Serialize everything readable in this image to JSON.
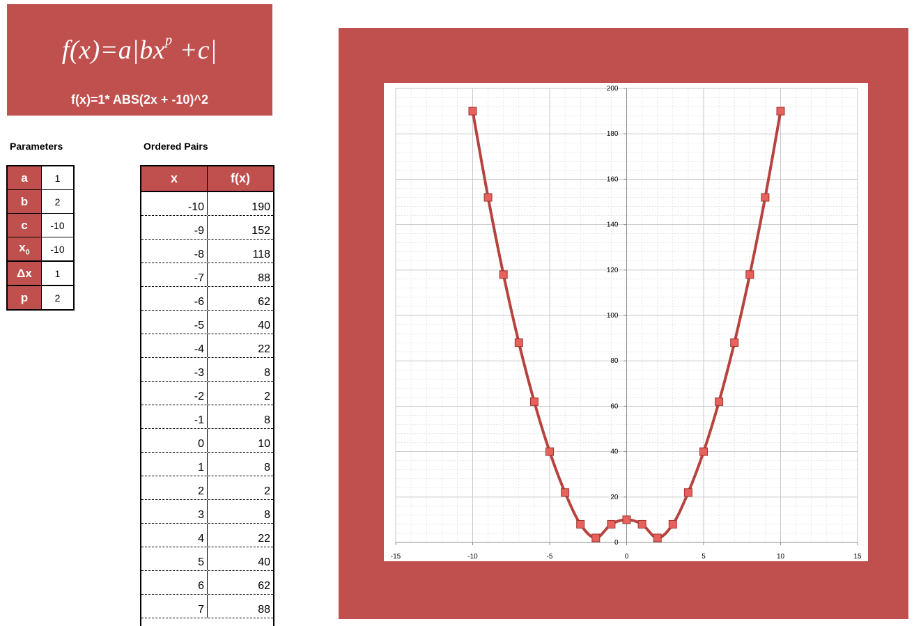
{
  "formula": {
    "main_prefix": "f(x)=a|bx",
    "main_exponent": "p",
    "main_suffix": " +c|",
    "evaluated": "f(x)=1* ABS(2x + -10)^2"
  },
  "parameters": {
    "title": "Parameters",
    "rows": [
      {
        "name": "a",
        "value": "1"
      },
      {
        "name": "b",
        "value": "2"
      },
      {
        "name": "c",
        "value": "-10"
      },
      {
        "name": "x0",
        "value": "-10"
      },
      {
        "name": "Δx",
        "value": "1"
      },
      {
        "name": "p",
        "value": "2"
      }
    ]
  },
  "ordered_pairs": {
    "title": "Ordered Pairs",
    "headers": [
      "x",
      "f(x)"
    ],
    "rows": [
      [
        "-10",
        "190"
      ],
      [
        "-9",
        "152"
      ],
      [
        "-8",
        "118"
      ],
      [
        "-7",
        "88"
      ],
      [
        "-6",
        "62"
      ],
      [
        "-5",
        "40"
      ],
      [
        "-4",
        "22"
      ],
      [
        "-3",
        "8"
      ],
      [
        "-2",
        "2"
      ],
      [
        "-1",
        "8"
      ],
      [
        "0",
        "10"
      ],
      [
        "1",
        "8"
      ],
      [
        "2",
        "2"
      ],
      [
        "3",
        "8"
      ],
      [
        "4",
        "22"
      ],
      [
        "5",
        "40"
      ],
      [
        "6",
        "62"
      ],
      [
        "7",
        "88"
      ]
    ]
  },
  "colors": {
    "accent": "#c0504d",
    "line": "#b6433f",
    "marker": "#e8625d",
    "grid": "#d8d8d8"
  },
  "chart_data": {
    "type": "scatter",
    "x": [
      -10,
      -9,
      -8,
      -7,
      -6,
      -5,
      -4,
      -3,
      -2,
      -1,
      0,
      1,
      2,
      3,
      4,
      5,
      6,
      7,
      8,
      9,
      10
    ],
    "series": [
      {
        "values": [
          190,
          152,
          118,
          88,
          62,
          40,
          22,
          8,
          2,
          8,
          10,
          8,
          2,
          8,
          22,
          40,
          62,
          88,
          118,
          152,
          190
        ]
      }
    ],
    "xlim": [
      -15,
      15
    ],
    "ylim": [
      0,
      200
    ],
    "xticks": [
      -15,
      -10,
      -5,
      0,
      5,
      10,
      15
    ],
    "yticks": [
      0,
      20,
      40,
      60,
      80,
      100,
      120,
      140,
      160,
      180,
      200
    ],
    "smooth_line": true,
    "markers": "square",
    "grid": true,
    "legend": "none"
  }
}
